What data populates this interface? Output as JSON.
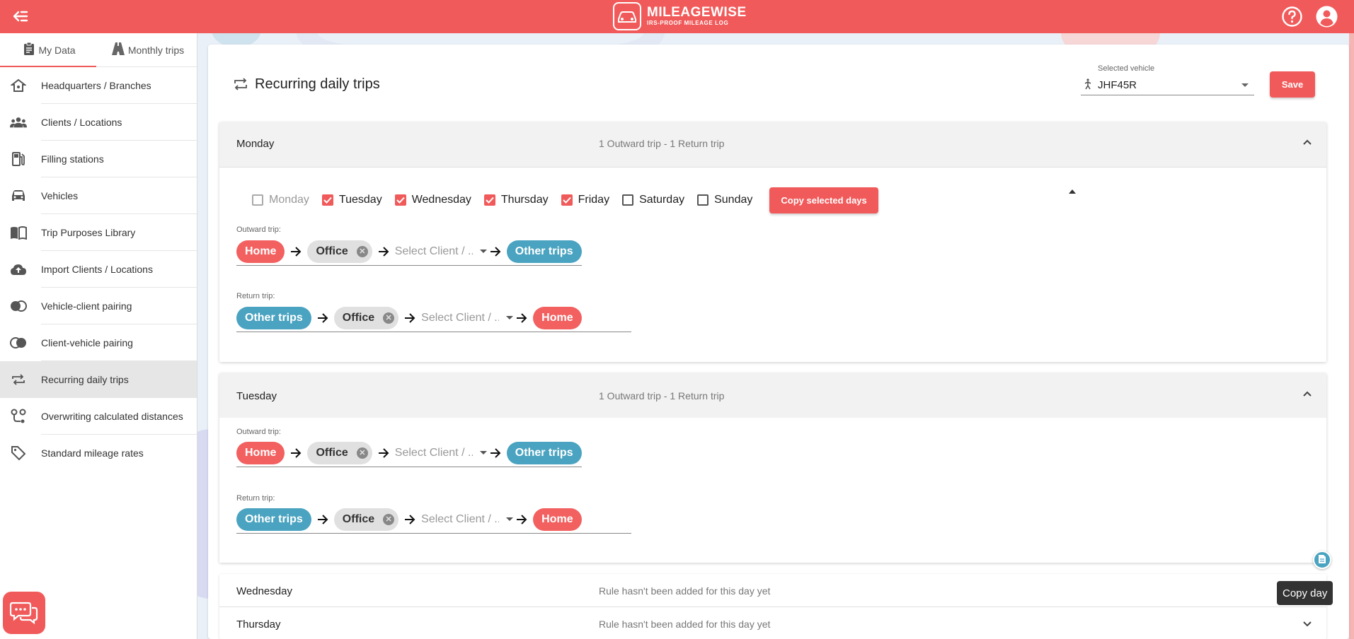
{
  "app": {
    "logo_name": "MILEAGEWISE",
    "logo_tagline": "IRS-PROOF MILEAGE LOG"
  },
  "sidebar": {
    "tabs": [
      {
        "label": "My Data",
        "icon": "clipboard-icon",
        "active": true
      },
      {
        "label": "Monthly trips",
        "icon": "road-icon",
        "active": false
      }
    ],
    "items": [
      {
        "label": "Headquarters / Branches",
        "icon": "home-icon"
      },
      {
        "label": "Clients / Locations",
        "icon": "people-icon"
      },
      {
        "label": "Filling stations",
        "icon": "gas-station-icon"
      },
      {
        "label": "Vehicles",
        "icon": "car-icon"
      },
      {
        "label": "Trip Purposes Library",
        "icon": "book-icon"
      },
      {
        "label": "Import Clients / Locations",
        "icon": "cloud-upload-icon"
      },
      {
        "label": "Vehicle-client pairing",
        "icon": "pairing-icon"
      },
      {
        "label": "Client-vehicle pairing",
        "icon": "pairing-icon"
      },
      {
        "label": "Recurring daily trips",
        "icon": "repeat-icon",
        "active": true
      },
      {
        "label": "Overwriting calculated distances",
        "icon": "route-icon"
      },
      {
        "label": "Standard mileage rates",
        "icon": "tag-icon"
      }
    ]
  },
  "header": {
    "title": "Recurring daily trips",
    "vehicle_label": "Selected vehicle",
    "vehicle_value": "JHF45R",
    "save_label": "Save"
  },
  "days": [
    {
      "name": "Monday",
      "summary": "1 Outward trip - 1 Return trip",
      "copy": {
        "options": [
          {
            "label": "Monday",
            "checked": false,
            "disabled": true
          },
          {
            "label": "Tuesday",
            "checked": true
          },
          {
            "label": "Wednesday",
            "checked": true
          },
          {
            "label": "Thursday",
            "checked": true
          },
          {
            "label": "Friday",
            "checked": true
          },
          {
            "label": "Saturday",
            "checked": false
          },
          {
            "label": "Sunday",
            "checked": false
          }
        ],
        "button_label": "Copy selected days"
      },
      "outward_label": "Outward trip:",
      "outward": {
        "start": "Home",
        "stop": "Office",
        "placeholder": "Select Client / ...",
        "end": "Other trips"
      },
      "return_label": "Return trip:",
      "return": {
        "start": "Other trips",
        "stop": "Office",
        "placeholder": "Select Client / ...",
        "end": "Home"
      }
    },
    {
      "name": "Tuesday",
      "summary": "1 Outward trip - 1 Return trip",
      "outward_label": "Outward trip:",
      "outward": {
        "start": "Home",
        "stop": "Office",
        "placeholder": "Select Client / ...",
        "end": "Other trips"
      },
      "return_label": "Return trip:",
      "return": {
        "start": "Other trips",
        "stop": "Office",
        "placeholder": "Select Client / ...",
        "end": "Home"
      }
    },
    {
      "name": "Wednesday",
      "summary": "Rule hasn't been added for this day yet"
    },
    {
      "name": "Thursday",
      "summary": "Rule hasn't been added for this day yet"
    }
  ],
  "tooltip": "Copy day",
  "colors": {
    "accent": "#f15a5a",
    "location_blue": "#4aa3c0",
    "chip_grey": "#e0e0e0"
  }
}
